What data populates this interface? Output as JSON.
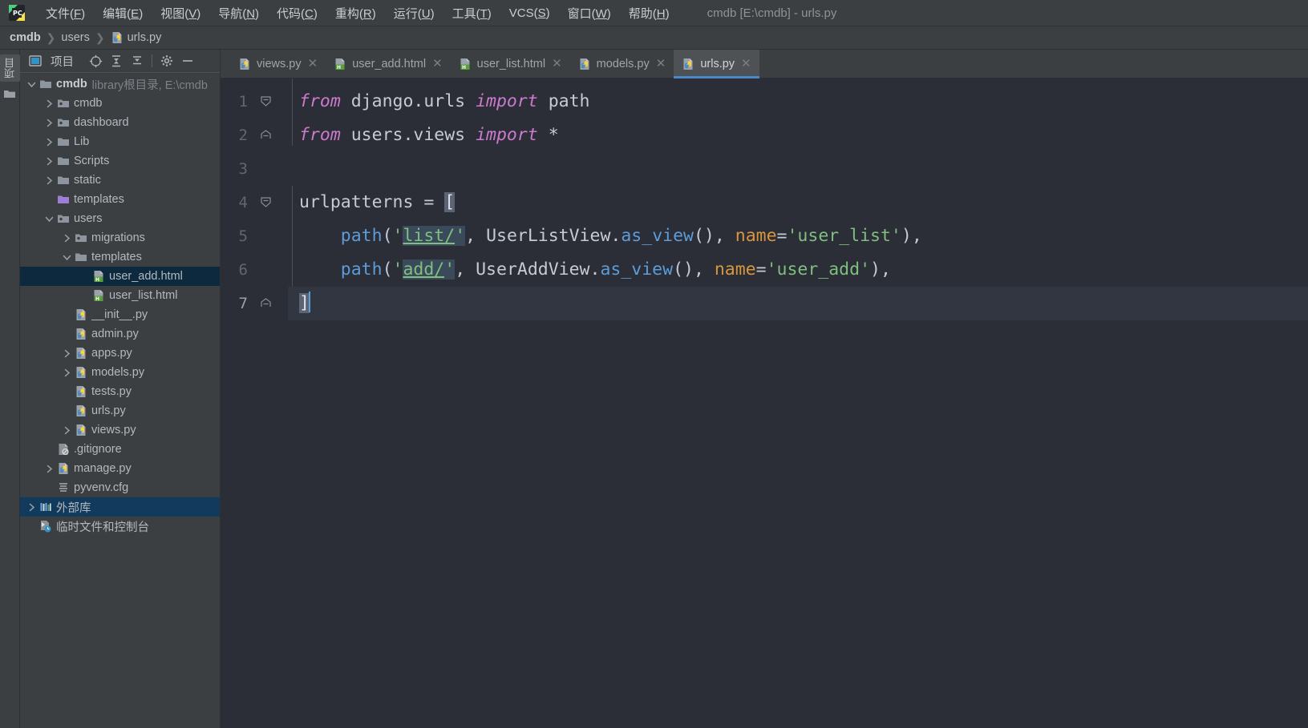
{
  "window": {
    "title": "cmdb [E:\\cmdb] - urls.py",
    "logo_icon": "pycharm-logo-icon"
  },
  "menubar": {
    "items": [
      {
        "label": "文件",
        "mnemonic": "F"
      },
      {
        "label": "编辑",
        "mnemonic": "E"
      },
      {
        "label": "视图",
        "mnemonic": "V"
      },
      {
        "label": "导航",
        "mnemonic": "N"
      },
      {
        "label": "代码",
        "mnemonic": "C"
      },
      {
        "label": "重构",
        "mnemonic": "R"
      },
      {
        "label": "运行",
        "mnemonic": "U"
      },
      {
        "label": "工具",
        "mnemonic": "T"
      },
      {
        "label": "VCS",
        "mnemonic": "S"
      },
      {
        "label": "窗口",
        "mnemonic": "W"
      },
      {
        "label": "帮助",
        "mnemonic": "H"
      }
    ]
  },
  "breadcrumb": {
    "items": [
      {
        "label": "cmdb",
        "bold": true,
        "icon": null
      },
      {
        "label": "users",
        "bold": false,
        "icon": null
      },
      {
        "label": "urls.py",
        "bold": false,
        "icon": "python-file-icon"
      }
    ],
    "separator": "❯"
  },
  "stripe": {
    "project_tab_label": "项目",
    "folder_icon": "folder-icon"
  },
  "project_panel": {
    "title": "项目",
    "title_icon": "project-view-icon",
    "buttons": [
      {
        "name": "select-opened-file-icon",
        "tooltip": "选择打开的文件"
      },
      {
        "name": "expand-all-icon",
        "tooltip": "全部展开"
      },
      {
        "name": "collapse-all-icon",
        "tooltip": "全部折叠"
      },
      {
        "name": "settings-gear-icon",
        "tooltip": "选项"
      },
      {
        "name": "hide-panel-icon",
        "tooltip": "隐藏"
      }
    ],
    "tree": [
      {
        "depth": 0,
        "label": "cmdb",
        "sub": "library根目录, E:\\cmdb",
        "icon": "folder-module-icon",
        "arrow": "open",
        "bold": true,
        "selected": false
      },
      {
        "depth": 1,
        "label": "cmdb",
        "sub": "",
        "icon": "folder-package-icon",
        "arrow": "closed",
        "bold": false,
        "selected": false
      },
      {
        "depth": 1,
        "label": "dashboard",
        "sub": "",
        "icon": "folder-package-icon",
        "arrow": "closed",
        "bold": false,
        "selected": false
      },
      {
        "depth": 1,
        "label": "Lib",
        "sub": "",
        "icon": "folder-icon",
        "arrow": "closed",
        "bold": false,
        "selected": false
      },
      {
        "depth": 1,
        "label": "Scripts",
        "sub": "",
        "icon": "folder-icon",
        "arrow": "closed",
        "bold": false,
        "selected": false
      },
      {
        "depth": 1,
        "label": "static",
        "sub": "",
        "icon": "folder-icon",
        "arrow": "closed",
        "bold": false,
        "selected": false
      },
      {
        "depth": 1,
        "label": "templates",
        "sub": "",
        "icon": "folder-templates-icon",
        "arrow": "none",
        "bold": false,
        "selected": false
      },
      {
        "depth": 1,
        "label": "users",
        "sub": "",
        "icon": "folder-package-icon",
        "arrow": "open",
        "bold": false,
        "selected": false
      },
      {
        "depth": 2,
        "label": "migrations",
        "sub": "",
        "icon": "folder-package-icon",
        "arrow": "closed",
        "bold": false,
        "selected": false
      },
      {
        "depth": 2,
        "label": "templates",
        "sub": "",
        "icon": "folder-icon",
        "arrow": "open",
        "bold": false,
        "selected": false
      },
      {
        "depth": 3,
        "label": "user_add.html",
        "sub": "",
        "icon": "html-file-icon",
        "arrow": "none",
        "bold": false,
        "selected": true
      },
      {
        "depth": 3,
        "label": "user_list.html",
        "sub": "",
        "icon": "html-file-icon",
        "arrow": "none",
        "bold": false,
        "selected": false
      },
      {
        "depth": 2,
        "label": "__init__.py",
        "sub": "",
        "icon": "python-file-icon",
        "arrow": "none",
        "bold": false,
        "selected": false
      },
      {
        "depth": 2,
        "label": "admin.py",
        "sub": "",
        "icon": "python-file-icon",
        "arrow": "none",
        "bold": false,
        "selected": false
      },
      {
        "depth": 2,
        "label": "apps.py",
        "sub": "",
        "icon": "python-file-icon",
        "arrow": "closed",
        "bold": false,
        "selected": false
      },
      {
        "depth": 2,
        "label": "models.py",
        "sub": "",
        "icon": "python-file-icon",
        "arrow": "closed",
        "bold": false,
        "selected": false
      },
      {
        "depth": 2,
        "label": "tests.py",
        "sub": "",
        "icon": "python-file-icon",
        "arrow": "none",
        "bold": false,
        "selected": false
      },
      {
        "depth": 2,
        "label": "urls.py",
        "sub": "",
        "icon": "python-file-icon",
        "arrow": "none",
        "bold": false,
        "selected": false
      },
      {
        "depth": 2,
        "label": "views.py",
        "sub": "",
        "icon": "python-file-icon",
        "arrow": "closed",
        "bold": false,
        "selected": false
      },
      {
        "depth": 1,
        "label": ".gitignore",
        "sub": "",
        "icon": "gitignore-file-icon",
        "arrow": "none",
        "bold": false,
        "selected": false
      },
      {
        "depth": 1,
        "label": "manage.py",
        "sub": "",
        "icon": "python-file-icon",
        "arrow": "closed",
        "bold": false,
        "selected": false
      },
      {
        "depth": 1,
        "label": "pyvenv.cfg",
        "sub": "",
        "icon": "config-file-icon",
        "arrow": "none",
        "bold": false,
        "selected": false
      },
      {
        "depth": 0,
        "label": "外部库",
        "sub": "",
        "icon": "external-libraries-icon",
        "arrow": "closed",
        "bold": false,
        "selected": false,
        "highlight": true
      },
      {
        "depth": 0,
        "label": "临时文件和控制台",
        "sub": "",
        "icon": "scratches-icon",
        "arrow": "none",
        "bold": false,
        "selected": false
      }
    ]
  },
  "editor": {
    "tabs": [
      {
        "label": "views.py",
        "icon": "python-file-icon",
        "active": false,
        "closable": true
      },
      {
        "label": "user_add.html",
        "icon": "html-file-icon",
        "active": false,
        "closable": true
      },
      {
        "label": "user_list.html",
        "icon": "html-file-icon",
        "active": false,
        "closable": true
      },
      {
        "label": "models.py",
        "icon": "python-file-icon",
        "active": false,
        "closable": true
      },
      {
        "label": "urls.py",
        "icon": "python-file-icon",
        "active": true,
        "closable": true
      }
    ],
    "line_numbers": [
      "1",
      "2",
      "3",
      "4",
      "5",
      "6",
      "7"
    ],
    "current_line": 7,
    "code_lines": [
      {
        "n": 1,
        "fold": "collapse-arrow",
        "text": "from django.urls import path"
      },
      {
        "n": 2,
        "fold": "fold-end",
        "text": "from users.views import *"
      },
      {
        "n": 3,
        "fold": null,
        "text": ""
      },
      {
        "n": 4,
        "fold": "collapse-arrow",
        "text": "urlpatterns = ["
      },
      {
        "n": 5,
        "fold": null,
        "text": "    path('list/', UserListView.as_view(), name='user_list'),"
      },
      {
        "n": 6,
        "fold": null,
        "text": "    path('add/', UserAddView.as_view(), name='user_add'),"
      },
      {
        "n": 7,
        "fold": "fold-end",
        "text": "]"
      }
    ]
  },
  "colors": {
    "panel_bg": "#3c3f41",
    "editor_bg": "#2b2d37",
    "tab_active_bg": "#4e5254",
    "tab_underline": "#4a88c7",
    "selection_bg": "#0d293e",
    "highlight_bg": "#113a5c",
    "keyword": "#cc7acc",
    "string": "#7fbf7f",
    "function": "#5d9cd8",
    "named_arg": "#d9963c",
    "text": "#a9b7c6",
    "caret": "#5a9fd4"
  }
}
